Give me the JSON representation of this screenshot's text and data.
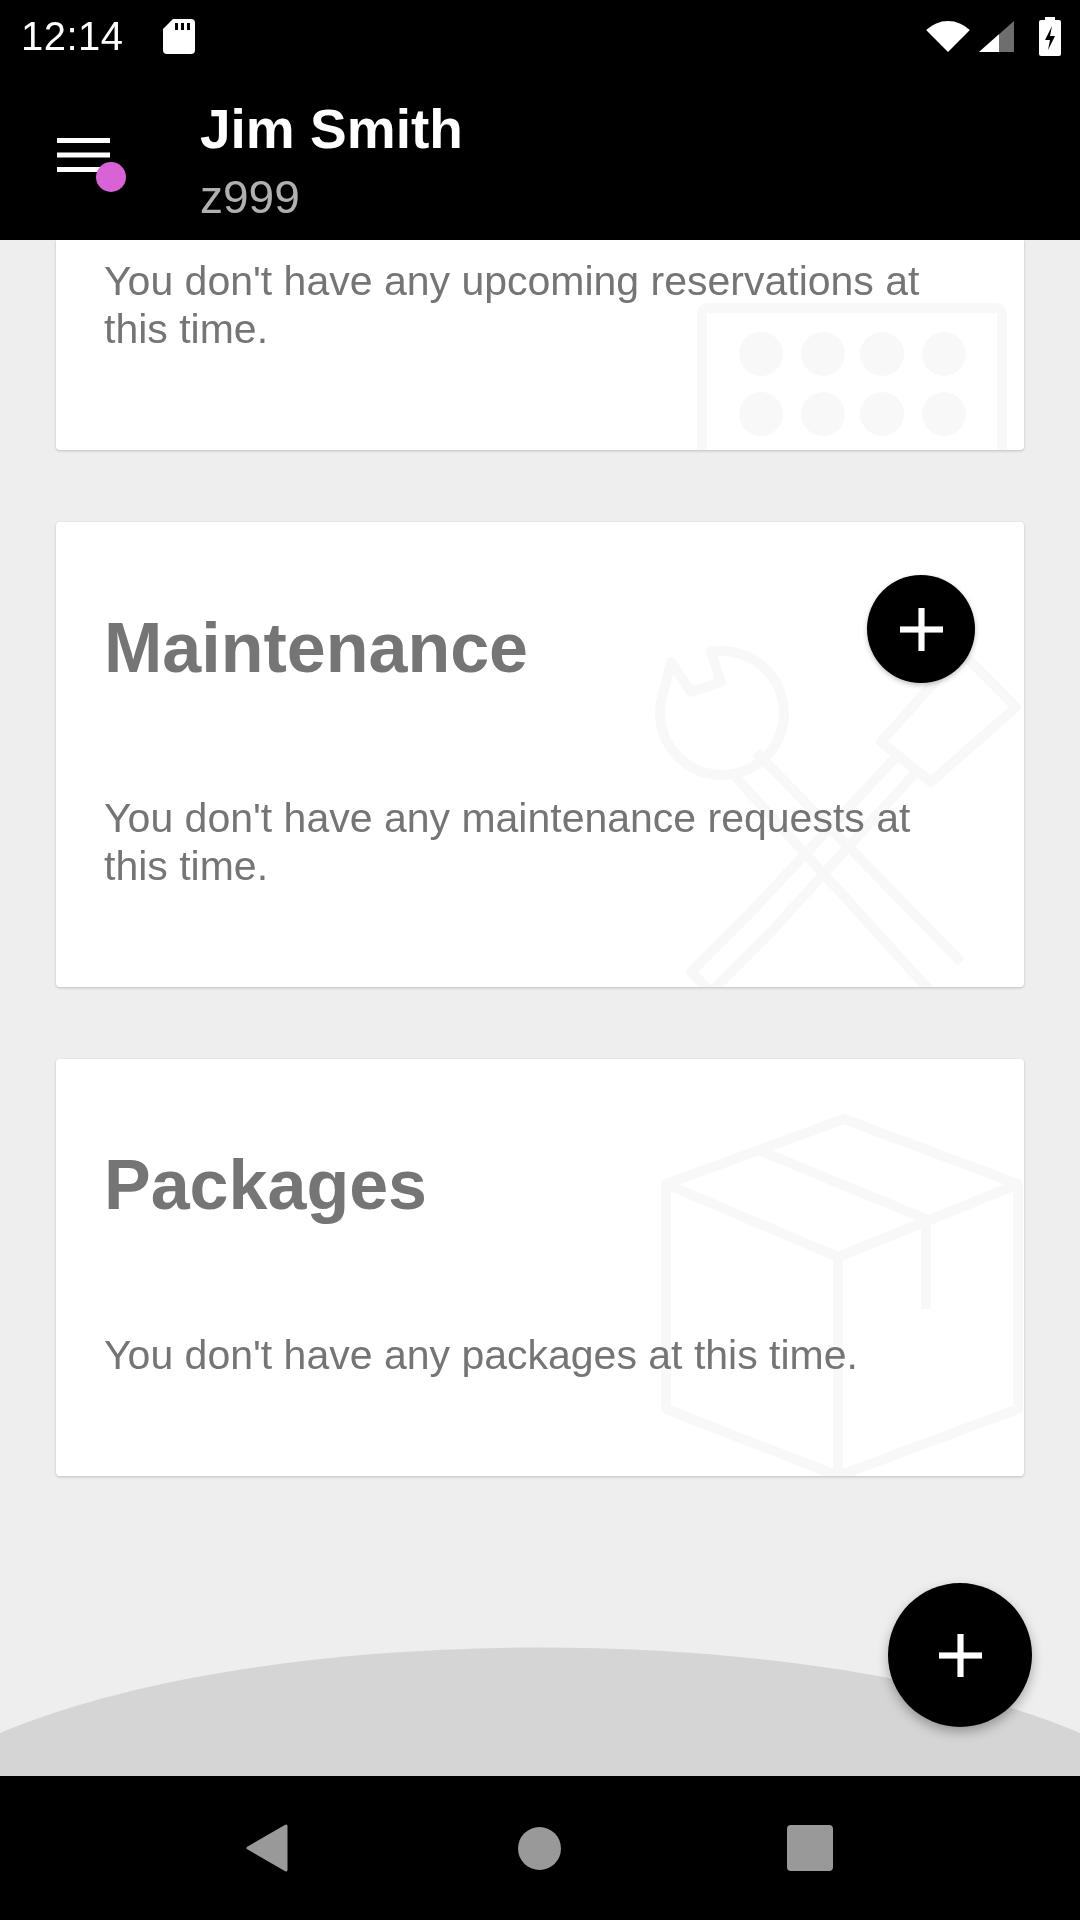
{
  "status_bar": {
    "time": "12:14"
  },
  "header": {
    "title": "Jim Smith",
    "subtitle": "z999",
    "menu_notification": true
  },
  "cards": [
    {
      "kind": "reservations",
      "message": "You don't have any upcoming reservations at this time.",
      "add_button": false
    },
    {
      "kind": "maintenance",
      "title": "Maintenance",
      "message": "You don't have any maintenance requests at this time.",
      "add_button": true
    },
    {
      "kind": "packages",
      "title": "Packages",
      "message": "You don't have any packages at this time.",
      "add_button": false
    }
  ]
}
